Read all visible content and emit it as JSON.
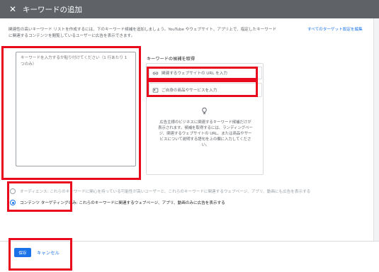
{
  "header": {
    "title": "キーワードの追加"
  },
  "intro": {
    "line1": "関連性の高いキーワード リストを作成するには、下のキーワード候補を追加しましょう。YouTube やウェブサイト、アプリ上で、指定したキーワード",
    "line2": "に関連するコンテンツを閲覧しているユーザーに広告を表示できます。"
  },
  "target_link": "すべてのターゲット設定を編集",
  "keyword_input": {
    "placeholder": "キーワードを入力するか貼り付けてください（1 行あたり 1 つのみ）"
  },
  "suggestions": {
    "title": "キーワードの候補を取得",
    "url_placeholder": "関連するウェブサイトの URL を入力",
    "product_placeholder": "ご自身の商品やサービスを入力",
    "help": "広告主様のビジネスに関連するキーワード候補だけが表示されます。候補を取得するには、ランディングページ、関連するウェブサイトの URL、または商品やサービスについて説明する語句を上の欄に入力してください。"
  },
  "options": [
    {
      "label": "オーディエンス: これらのキーワードに関心を持っている可能性が高いユーザーと、これらのキーワードに関連するウェブページ、アプリ、動画にも広告を表示する",
      "selected": false
    },
    {
      "label": "コンテンツ ターゲティングのみ: これらのキーワードに関連するウェブページ、アプリ、動画のみに広告を表示する",
      "selected": true
    }
  ],
  "footer": {
    "save": "保存",
    "cancel": "キャンセル"
  },
  "colors": {
    "header_bg": "#5f6368",
    "accent": "#1a73e8",
    "callout": "#ea0a1d"
  }
}
